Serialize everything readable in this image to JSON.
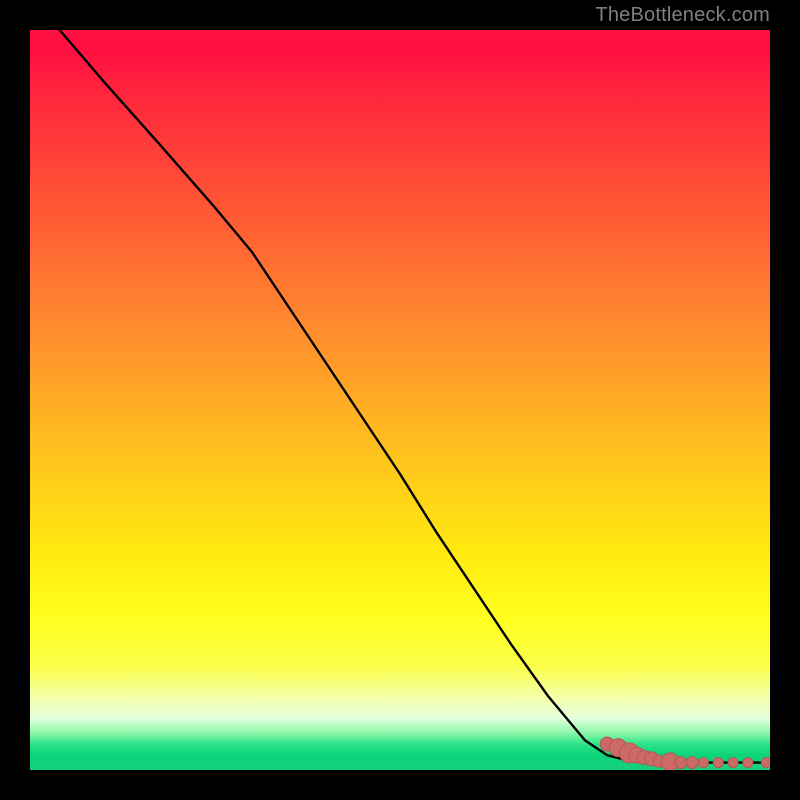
{
  "credit_text": "TheBottleneck.com",
  "colors": {
    "frame": "#000000",
    "credit": "#7f7f7f",
    "line": "#000000",
    "marker_fill": "#cb6a66",
    "marker_stroke": "#b85652"
  },
  "chart_data": {
    "type": "line",
    "title": "",
    "xlabel": "",
    "ylabel": "",
    "xlim": [
      0,
      100
    ],
    "ylim": [
      0,
      100
    ],
    "grid": false,
    "legend": false,
    "series": [
      {
        "name": "curve",
        "x": [
          4,
          10,
          18,
          25,
          30,
          35,
          40,
          45,
          50,
          55,
          60,
          65,
          70,
          75,
          78,
          80,
          82,
          84,
          86,
          88,
          90,
          92,
          94,
          96,
          98,
          100
        ],
        "y": [
          100,
          93,
          84,
          76,
          70,
          62.5,
          55,
          47.5,
          40,
          32,
          24.5,
          17,
          10,
          4,
          2,
          1.5,
          1.2,
          1.0,
          1.0,
          1.0,
          1.0,
          1.0,
          1.0,
          1.0,
          1.0,
          1.0
        ]
      }
    ],
    "markers": {
      "name": "highlight-points",
      "x": [
        78,
        79.5,
        81,
        82,
        83,
        84,
        85,
        86.5,
        88,
        89.5,
        91,
        93,
        95,
        97,
        99.5
      ],
      "y": [
        3.5,
        3.0,
        2.3,
        2.0,
        1.7,
        1.5,
        1.2,
        1.1,
        1.0,
        1.0,
        1.0,
        1.0,
        1.0,
        1.0,
        1.0
      ],
      "r": [
        7,
        9,
        10,
        8,
        7,
        7,
        6,
        9,
        6,
        6,
        5,
        5,
        5,
        5,
        5
      ]
    }
  }
}
